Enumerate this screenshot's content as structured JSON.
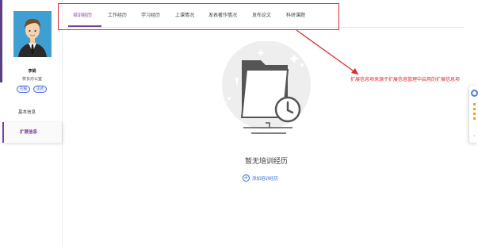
{
  "user": {
    "name": "李娟",
    "role": "校长办公室",
    "tags": [
      "在编",
      "正式"
    ]
  },
  "sidebar": {
    "items": [
      {
        "label": "基本信息",
        "active": false
      },
      {
        "label": "扩展信息",
        "active": true
      }
    ]
  },
  "tabs": [
    {
      "label": "培训经历",
      "active": true
    },
    {
      "label": "工作经历",
      "active": false
    },
    {
      "label": "学习经历",
      "active": false
    },
    {
      "label": "上课情况",
      "active": false
    },
    {
      "label": "发表著作情况",
      "active": false
    },
    {
      "label": "发布论文",
      "active": false
    },
    {
      "label": "科研课题",
      "active": false
    }
  ],
  "empty_state": {
    "title": "暂无培训经历",
    "add_label": "添加培训经历",
    "add_icon": "plus-circle-icon"
  },
  "annotation": {
    "text": "扩展信息项来源于扩展信息管理中启用的扩展信息项",
    "color": "#e02a2a"
  },
  "colors": {
    "accent": "#7b3fa0",
    "link": "#3a6ad4"
  }
}
